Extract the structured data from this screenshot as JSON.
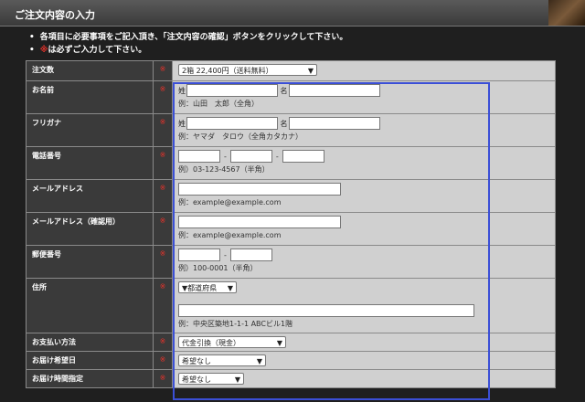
{
  "header": {
    "title": "ご注文内容の入力"
  },
  "instructions": {
    "line1": "各項目に必要事項をご記入頂き、「注文内容の確認」ボタンをクリックして下さい。",
    "line2_mark": "※",
    "line2_text": "は必ずご入力して下さい。"
  },
  "form": {
    "required_mark": "※",
    "order_qty": {
      "label": "注文数",
      "value": "2箱 22,400円（送料無料）"
    },
    "name": {
      "label": "お名前",
      "sei": "姓",
      "mei": "名",
      "example": "例：山田　太郎（全角）"
    },
    "furigana": {
      "label": "フリガナ",
      "sei": "姓",
      "mei": "名",
      "example": "例：ヤマダ　タロウ（全角カタカナ）"
    },
    "phone": {
      "label": "電話番号",
      "example": "例）03-123-4567（半角）"
    },
    "email": {
      "label": "メールアドレス",
      "example": "例：example@example.com"
    },
    "email_confirm": {
      "label": "メールアドレス（確認用）",
      "example": "例：example@example.com"
    },
    "postal": {
      "label": "郵便番号",
      "example": "例）100-0001（半角）"
    },
    "address": {
      "label": "住所",
      "prefecture": "▼都道府県",
      "example": "例：中央区築地1-1-1 ABCビル1階"
    },
    "payment": {
      "label": "お支払い方法",
      "value": "代金引換（現金）"
    },
    "delivery_date": {
      "label": "お届け希望日",
      "value": "希望なし"
    },
    "delivery_time": {
      "label": "お届け時間指定",
      "value": "希望なし"
    }
  }
}
